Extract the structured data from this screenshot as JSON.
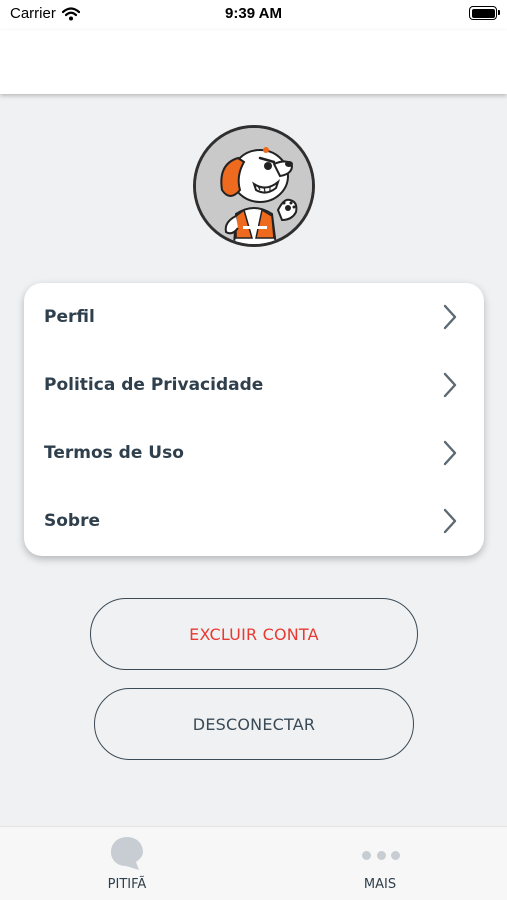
{
  "status_bar": {
    "carrier": "Carrier",
    "time": "9:39 AM"
  },
  "menu": {
    "items": [
      {
        "label": "Perfil"
      },
      {
        "label": "Politica de Privacidade"
      },
      {
        "label": "Termos de Uso"
      },
      {
        "label": "Sobre"
      }
    ]
  },
  "actions": {
    "delete_label": "EXCLUIR CONTA",
    "logout_label": "DESCONECTAR"
  },
  "tab_bar": {
    "tabs": [
      {
        "label": "PITIFÃ",
        "icon": "chat-bubble-icon"
      },
      {
        "label": "MAIS",
        "icon": "more-dots-icon"
      }
    ]
  },
  "colors": {
    "delete_text": "#e83a32",
    "background": "#eff1f3",
    "text": "#2f3f4c",
    "mascot_orange": "#ee6a1e"
  }
}
